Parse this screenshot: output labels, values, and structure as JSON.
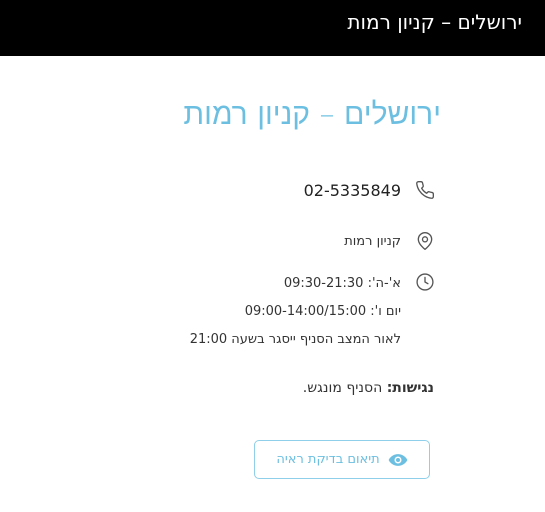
{
  "header": {
    "title": "ירושלים – קניון רמות"
  },
  "store": {
    "title": "ירושלים – קניון רמות",
    "phone": "02-5335849",
    "location": "קניון רמות",
    "hours": [
      "א'-ה': 09:30-21:30",
      "יום ו': 09:00-14:00/15:00",
      "לאור המצב הסניף ייסגר בשעה 21:00"
    ],
    "accessibility_label": "נגישות:",
    "accessibility_text": " הסניף מונגש."
  },
  "actions": {
    "schedule_button": "תיאום בדיקת ראיה"
  },
  "colors": {
    "accent": "#6cbfe1",
    "topbar": "#000000"
  },
  "icons": {
    "phone": "phone-icon",
    "location": "map-pin-icon",
    "hours": "clock-icon",
    "schedule": "eye-icon"
  }
}
